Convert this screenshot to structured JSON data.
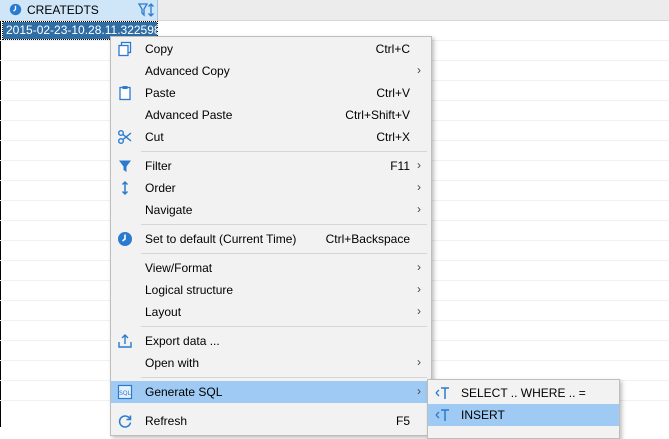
{
  "grid": {
    "column_header": "CREATEDTS",
    "selected_cell_value": "2015-02-23-10.28.11.322598"
  },
  "menu": {
    "items": [
      {
        "label": "Copy",
        "shortcut": "Ctrl+C",
        "icon": "copy-icon"
      },
      {
        "label": "Advanced Copy",
        "shortcut": "",
        "icon": ""
      },
      {
        "label": "Paste",
        "shortcut": "Ctrl+V",
        "icon": "paste-icon"
      },
      {
        "label": "Advanced Paste",
        "shortcut": "Ctrl+Shift+V",
        "icon": ""
      },
      {
        "label": "Cut",
        "shortcut": "Ctrl+X",
        "icon": "scissors-icon"
      },
      {
        "label": "Filter",
        "shortcut": "F11",
        "icon": "filter-icon"
      },
      {
        "label": "Order",
        "shortcut": "",
        "icon": "sort-icon"
      },
      {
        "label": "Navigate",
        "shortcut": "",
        "icon": ""
      },
      {
        "label": "Set to default (Current Time)",
        "shortcut": "Ctrl+Backspace",
        "icon": "clock-icon"
      },
      {
        "label": "View/Format",
        "shortcut": "",
        "icon": ""
      },
      {
        "label": "Logical structure",
        "shortcut": "",
        "icon": ""
      },
      {
        "label": "Layout",
        "shortcut": "",
        "icon": ""
      },
      {
        "label": "Export data ...",
        "shortcut": "",
        "icon": "export-icon"
      },
      {
        "label": "Open with",
        "shortcut": "",
        "icon": ""
      },
      {
        "label": "Generate SQL",
        "shortcut": "",
        "icon": "sql-icon"
      },
      {
        "label": "Refresh",
        "shortcut": "F5",
        "icon": "refresh-icon"
      }
    ],
    "submenu_arrow": "›"
  },
  "submenu": {
    "items": [
      {
        "label": "SELECT .. WHERE .. =",
        "icon": "sql-template-icon"
      },
      {
        "label": "INSERT",
        "icon": "sql-template-icon"
      }
    ]
  },
  "colors": {
    "header_bg": "#cfe6f8",
    "selection_bg": "#2f6ea5",
    "menu_bg": "#f2f2f2",
    "menu_highlight": "#9fcaf3",
    "icon_blue": "#2a7bd0"
  }
}
